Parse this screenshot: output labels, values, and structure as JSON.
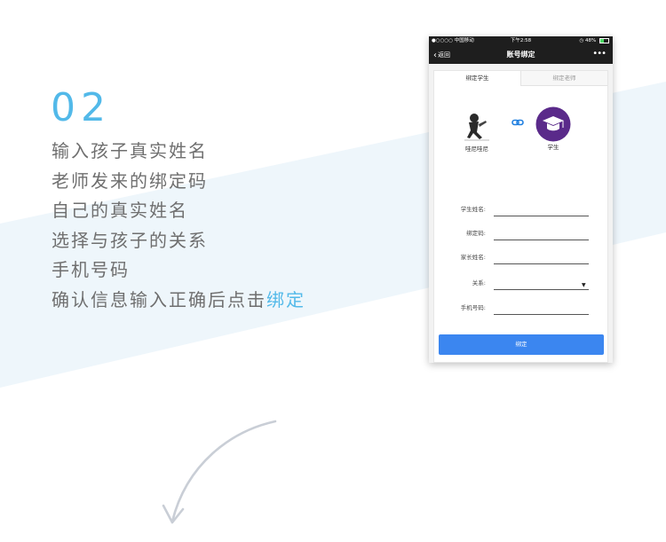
{
  "intro": {
    "step_number": "02",
    "lines": [
      "输入孩子真实姓名",
      "老师发来的绑定码",
      "自己的真实姓名",
      "选择与孩子的关系",
      "手机号码"
    ],
    "last_line_prefix": "确认信息输入正确后点击",
    "last_line_highlight": "绑定",
    "highlight_color": "#52b9e9"
  },
  "phone": {
    "status_bar": {
      "carrier": "●○○○○ 中国移动",
      "time": "下午2:58",
      "battery": "48%",
      "battery_level": 0.48
    },
    "nav": {
      "back_label": "返回",
      "title": "账号绑定",
      "more_icon": "more-icon"
    },
    "tabs": [
      {
        "label": "绑定学生",
        "active": true
      },
      {
        "label": "绑定老师",
        "active": false
      }
    ],
    "parent_avatar_label": "哇尼哇尼",
    "student_avatar_label": "学生",
    "student_avatar_color": "#5a2a8a",
    "link_icon_color": "#1f7fe0",
    "form": {
      "student_name_label": "学生姓名:",
      "bind_code_label": "绑定码:",
      "parent_name_label": "家长姓名:",
      "relation_label": "关系:",
      "phone_label": "手机号码:",
      "student_name_value": "",
      "bind_code_value": "",
      "parent_name_value": "",
      "relation_value": "",
      "phone_value": ""
    },
    "submit_label": "绑定",
    "accent_color": "#3b86f0"
  }
}
